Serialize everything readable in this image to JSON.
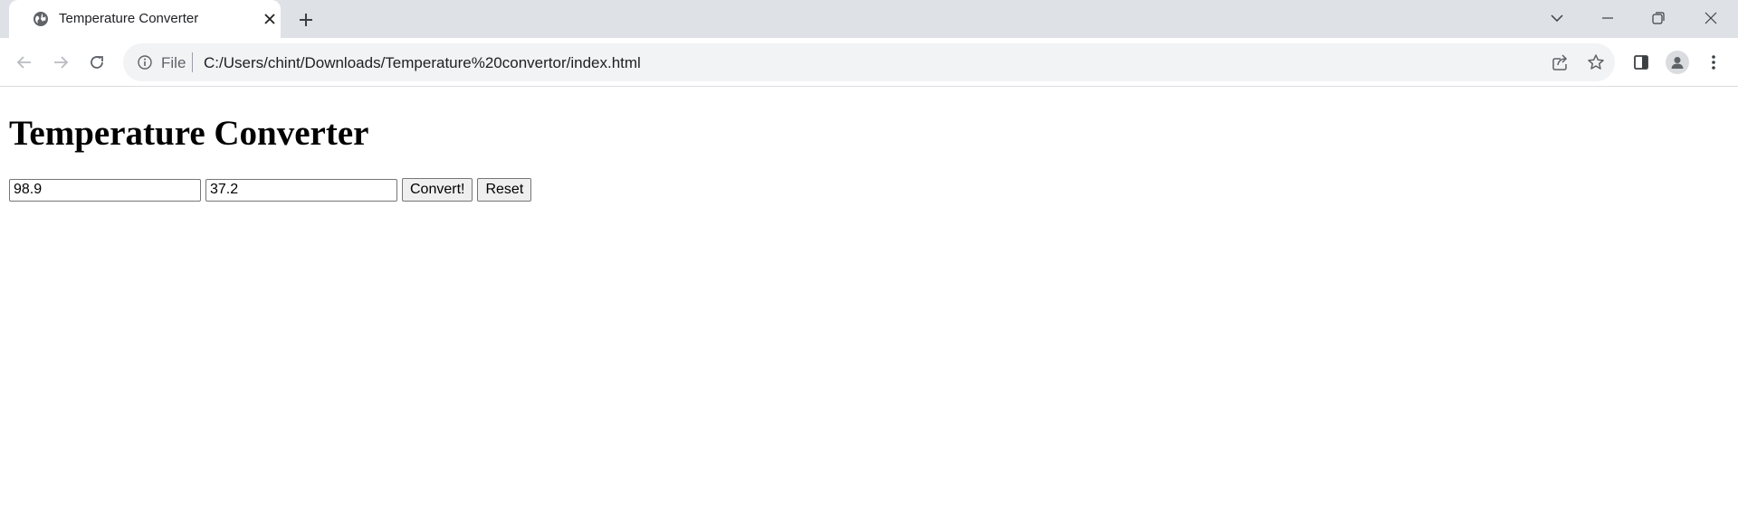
{
  "browser": {
    "tab": {
      "title": "Temperature Converter",
      "favicon": "globe-icon"
    },
    "new_tab_icon": "plus-icon",
    "window_controls": [
      "tab-search-icon",
      "minimize-icon",
      "restore-icon",
      "close-icon"
    ],
    "toolbar": {
      "icons": [
        "back-arrow-icon",
        "forward-arrow-icon",
        "reload-icon",
        "share-icon",
        "star-icon",
        "side-panel-icon",
        "profile-icon",
        "more-vert-icon"
      ]
    },
    "omnibox": {
      "scheme_label": "File",
      "url": "C:/Users/chint/Downloads/Temperature%20convertor/index.html"
    }
  },
  "page": {
    "title": "Temperature Converter",
    "fahrenheit_value": "98.9",
    "celsius_value": "37.2",
    "convert_label": "Convert!",
    "reset_label": "Reset"
  },
  "colors": {
    "tabstrip_bg": "#dee1e6",
    "omnibox_bg": "#f1f3f4",
    "icon": "#5f6368"
  }
}
